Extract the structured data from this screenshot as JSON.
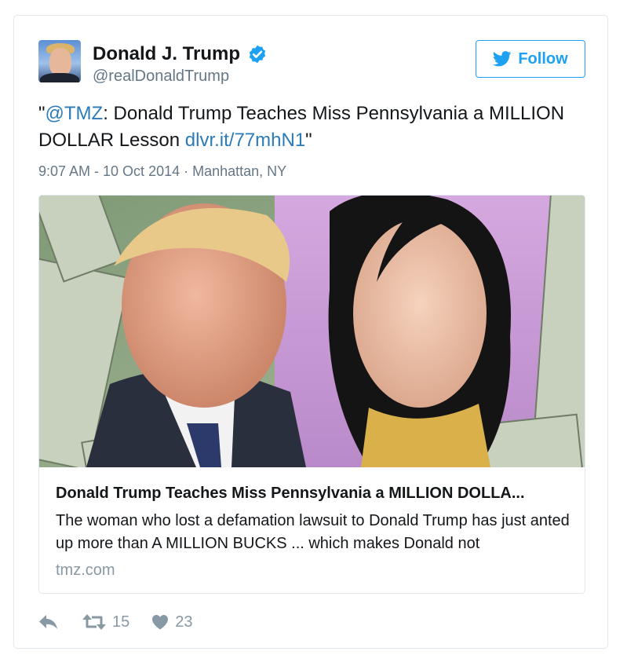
{
  "user": {
    "name": "Donald J. Trump",
    "handle": "@realDonaldTrump",
    "verified": true
  },
  "follow_button": {
    "label": "Follow",
    "icon": "twitter-bird-icon"
  },
  "tweet": {
    "text_parts": [
      {
        "type": "text",
        "value": "\""
      },
      {
        "type": "mention",
        "value": "@TMZ"
      },
      {
        "type": "text",
        "value": ": Donald Trump Teaches Miss Pennsylvania a MILLION DOLLAR Lesson "
      },
      {
        "type": "link",
        "value": "dlvr.it/77mhN1"
      },
      {
        "type": "text",
        "value": "\""
      }
    ],
    "timestamp": "9:07 AM - 10 Oct 2014 · Manhattan, NY"
  },
  "card": {
    "title": "Donald Trump Teaches Miss Pennsylvania a MILLION DOLLA...",
    "description": "The woman who lost a defamation lawsuit to Donald Trump has just anted up more than A MILLION BUCKS ... which makes Donald not",
    "domain": "tmz.com"
  },
  "actions": {
    "reply": {
      "icon": "reply-icon"
    },
    "retweet": {
      "icon": "retweet-icon",
      "count": "15"
    },
    "like": {
      "icon": "heart-icon",
      "count": "23"
    }
  },
  "colors": {
    "link": "#2b7bb9",
    "accent": "#1da1f2",
    "muted": "#657786",
    "icon": "#8899a6"
  }
}
